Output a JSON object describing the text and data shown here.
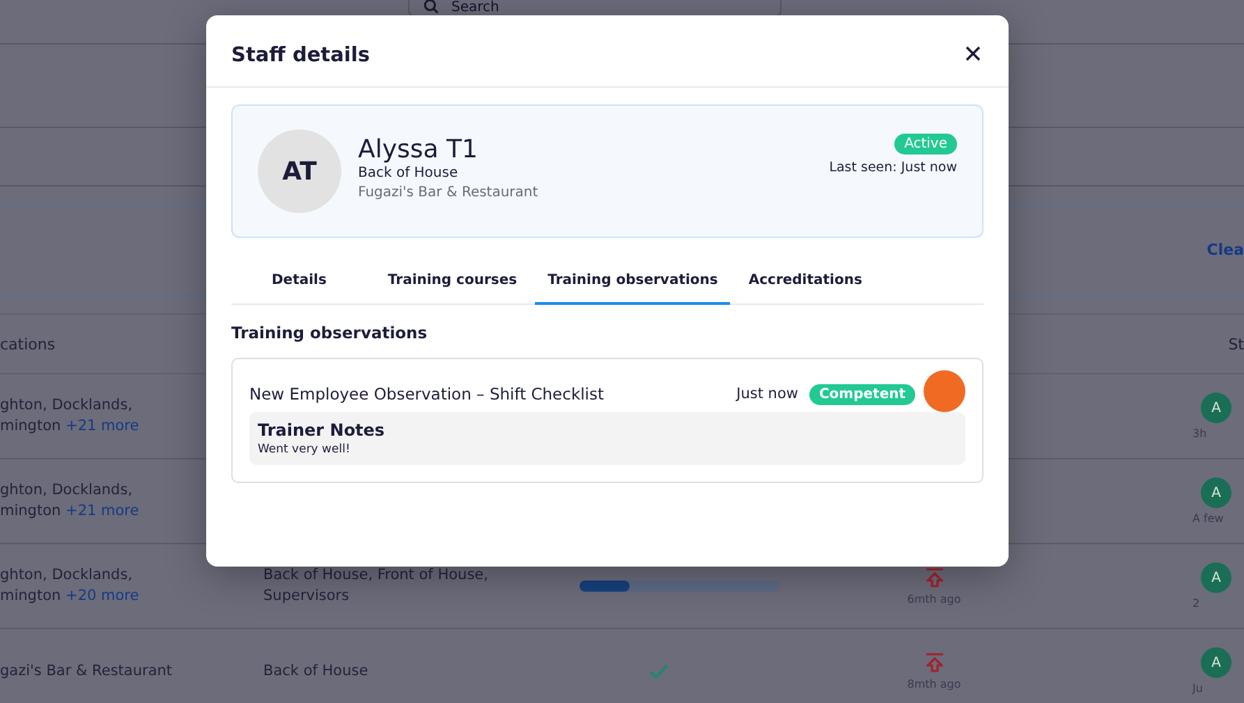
{
  "background": {
    "search": {
      "placeholder": "Search"
    },
    "clear_link": "Clea",
    "table": {
      "columns": [
        "cations",
        "St"
      ],
      "rows": [
        {
          "locations": [
            "ghton, Docklands,",
            "mington"
          ],
          "more": "+21 more",
          "status": "A",
          "status_time": "3h"
        },
        {
          "locations": [
            "ghton, Docklands,",
            "mington"
          ],
          "more": "+21 more",
          "status": "A",
          "status_time": "A few"
        },
        {
          "locations": [
            "ghton, Docklands,",
            "mington"
          ],
          "more": "+20 more",
          "areas": "Back of House, Front of House, Supervisors",
          "progress": {
            "kind": "bar",
            "level": 0.25
          },
          "updated": "6mth ago",
          "status": "A",
          "status_time": "2"
        },
        {
          "locations": [
            "gazi's Bar & Restaurant"
          ],
          "areas": "Back of House",
          "progress": {
            "kind": "check"
          },
          "updated": "8mth ago",
          "status": "A",
          "status_time": "Ju"
        }
      ]
    }
  },
  "dialog": {
    "title": "Staff details",
    "profile": {
      "initials": "AT",
      "name": "Alyssa T1",
      "area": "Back of House",
      "venue": "Fugazi's Bar & Restaurant",
      "status": "Active",
      "last_seen": "Last seen: Just now"
    },
    "tabs": [
      {
        "label": "Details",
        "selected": false
      },
      {
        "label": "Training courses",
        "selected": false
      },
      {
        "label": "Training observations",
        "selected": true
      },
      {
        "label": "Accreditations",
        "selected": false
      }
    ],
    "section_title": "Training observations",
    "observations": [
      {
        "title": "New Employee Observation – Shift Checklist",
        "time": "Just now",
        "result": "Competent",
        "notes_title": "Trainer Notes",
        "notes": "Went very well!"
      }
    ]
  }
}
